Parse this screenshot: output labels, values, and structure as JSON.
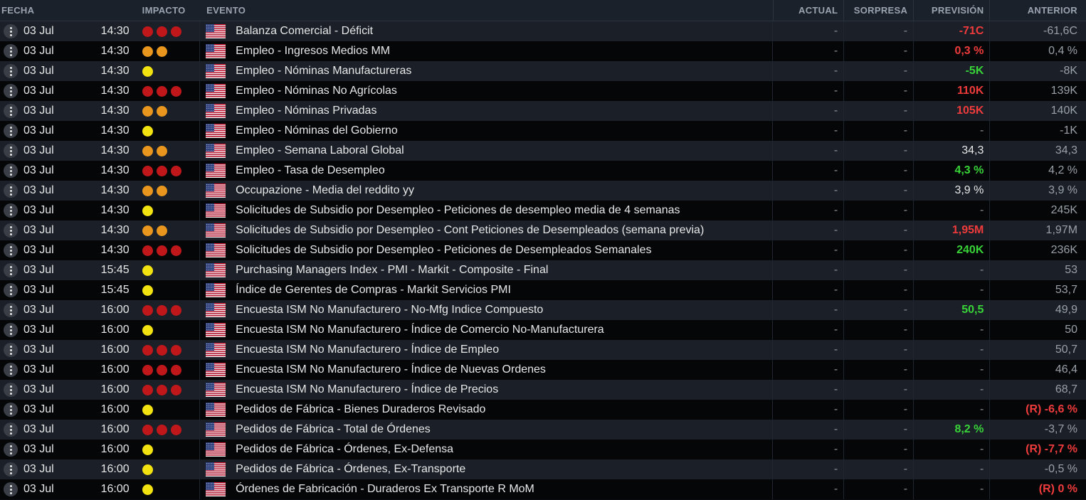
{
  "header": {
    "fecha": "FECHA",
    "impacto": "IMPACTO",
    "evento": "EVENTO",
    "actual": "ACTUAL",
    "sorpresa": "SORPRESA",
    "prevision": "PREVISIÓN",
    "anterior": "ANTERIOR"
  },
  "colors": {
    "high": "#c0171b",
    "medium": "#e8961e",
    "low": "#f2e20f",
    "red": "#ef3b3b",
    "green": "#38d438",
    "neutral": "#e8e8e8",
    "muted": "#9aa0a8"
  },
  "icons": {
    "menu": "more-vertical-icon",
    "flag": "us-flag-icon",
    "impact": "impact-dot-icon"
  },
  "rows": [
    {
      "date": "03 Jul",
      "time": "14:30",
      "impact": 3,
      "event": "Balanza Comercial - Déficit",
      "actual": "-",
      "surprise": "-",
      "forecast": "-71C",
      "forecast_color": "red",
      "previous": "-61,6C",
      "previous_color": "muted"
    },
    {
      "date": "03 Jul",
      "time": "14:30",
      "impact": 2,
      "event": "Empleo - Ingresos Medios MM",
      "actual": "-",
      "surprise": "-",
      "forecast": "0,3 %",
      "forecast_color": "red",
      "previous": "0,4 %",
      "previous_color": "muted"
    },
    {
      "date": "03 Jul",
      "time": "14:30",
      "impact": 1,
      "event": "Empleo - Nóminas Manufactureras",
      "actual": "-",
      "surprise": "-",
      "forecast": "-5K",
      "forecast_color": "green",
      "previous": "-8K",
      "previous_color": "muted"
    },
    {
      "date": "03 Jul",
      "time": "14:30",
      "impact": 3,
      "event": "Empleo - Nóminas No Agrícolas",
      "actual": "-",
      "surprise": "-",
      "forecast": "110K",
      "forecast_color": "red",
      "previous": "139K",
      "previous_color": "muted"
    },
    {
      "date": "03 Jul",
      "time": "14:30",
      "impact": 2,
      "event": "Empleo - Nóminas Privadas",
      "actual": "-",
      "surprise": "-",
      "forecast": "105K",
      "forecast_color": "red",
      "previous": "140K",
      "previous_color": "muted"
    },
    {
      "date": "03 Jul",
      "time": "14:30",
      "impact": 1,
      "event": "Empleo - Nóminas del Gobierno",
      "actual": "-",
      "surprise": "-",
      "forecast": "-",
      "forecast_color": "dash",
      "previous": "-1K",
      "previous_color": "muted"
    },
    {
      "date": "03 Jul",
      "time": "14:30",
      "impact": 2,
      "event": "Empleo - Semana Laboral Global",
      "actual": "-",
      "surprise": "-",
      "forecast": "34,3",
      "forecast_color": "neutral",
      "previous": "34,3",
      "previous_color": "muted"
    },
    {
      "date": "03 Jul",
      "time": "14:30",
      "impact": 3,
      "event": "Empleo - Tasa de Desempleo",
      "actual": "-",
      "surprise": "-",
      "forecast": "4,3 %",
      "forecast_color": "green",
      "previous": "4,2 %",
      "previous_color": "muted"
    },
    {
      "date": "03 Jul",
      "time": "14:30",
      "impact": 2,
      "event": "Occupazione - Media del reddito yy",
      "actual": "-",
      "surprise": "-",
      "forecast": "3,9 %",
      "forecast_color": "neutral",
      "previous": "3,9 %",
      "previous_color": "muted"
    },
    {
      "date": "03 Jul",
      "time": "14:30",
      "impact": 1,
      "event": "Solicitudes de Subsidio por Desempleo - Peticiones de desempleo media de 4 semanas",
      "actual": "-",
      "surprise": "-",
      "forecast": "-",
      "forecast_color": "dash",
      "previous": "245K",
      "previous_color": "muted"
    },
    {
      "date": "03 Jul",
      "time": "14:30",
      "impact": 2,
      "event": "Solicitudes de Subsidio por Desempleo - Cont Peticiones de Desempleados (semana previa)",
      "actual": "-",
      "surprise": "-",
      "forecast": "1,95M",
      "forecast_color": "red",
      "previous": "1,97M",
      "previous_color": "muted"
    },
    {
      "date": "03 Jul",
      "time": "14:30",
      "impact": 3,
      "event": "Solicitudes de Subsidio por Desempleo - Peticiones de Desempleados Semanales",
      "actual": "-",
      "surprise": "-",
      "forecast": "240K",
      "forecast_color": "green",
      "previous": "236K",
      "previous_color": "muted"
    },
    {
      "date": "03 Jul",
      "time": "15:45",
      "impact": 1,
      "event": "Purchasing Managers Index - PMI - Markit - Composite - Final",
      "actual": "-",
      "surprise": "-",
      "forecast": "-",
      "forecast_color": "dash",
      "previous": "53",
      "previous_color": "muted"
    },
    {
      "date": "03 Jul",
      "time": "15:45",
      "impact": 1,
      "event": "Índice de Gerentes de Compras - Markit Servicios PMI",
      "actual": "-",
      "surprise": "-",
      "forecast": "-",
      "forecast_color": "dash",
      "previous": "53,7",
      "previous_color": "muted"
    },
    {
      "date": "03 Jul",
      "time": "16:00",
      "impact": 3,
      "event": "Encuesta ISM No Manufacturero - No-Mfg Indice Compuesto",
      "actual": "-",
      "surprise": "-",
      "forecast": "50,5",
      "forecast_color": "green",
      "previous": "49,9",
      "previous_color": "muted"
    },
    {
      "date": "03 Jul",
      "time": "16:00",
      "impact": 1,
      "event": "Encuesta ISM No Manufacturero - Índice de Comercio No-Manufacturera",
      "actual": "-",
      "surprise": "-",
      "forecast": "-",
      "forecast_color": "dash",
      "previous": "50",
      "previous_color": "muted"
    },
    {
      "date": "03 Jul",
      "time": "16:00",
      "impact": 3,
      "event": "Encuesta ISM No Manufacturero - Índice de Empleo",
      "actual": "-",
      "surprise": "-",
      "forecast": "-",
      "forecast_color": "dash",
      "previous": "50,7",
      "previous_color": "muted"
    },
    {
      "date": "03 Jul",
      "time": "16:00",
      "impact": 3,
      "event": "Encuesta ISM No Manufacturero - Índice de Nuevas Ordenes",
      "actual": "-",
      "surprise": "-",
      "forecast": "-",
      "forecast_color": "dash",
      "previous": "46,4",
      "previous_color": "muted"
    },
    {
      "date": "03 Jul",
      "time": "16:00",
      "impact": 3,
      "event": "Encuesta ISM No Manufacturero - Índice de Precios",
      "actual": "-",
      "surprise": "-",
      "forecast": "-",
      "forecast_color": "dash",
      "previous": "68,7",
      "previous_color": "muted"
    },
    {
      "date": "03 Jul",
      "time": "16:00",
      "impact": 1,
      "event": "Pedidos de Fábrica - Bienes Duraderos Revisado",
      "actual": "-",
      "surprise": "-",
      "forecast": "-",
      "forecast_color": "dash",
      "previous": "(R) -6,6 %",
      "previous_color": "red"
    },
    {
      "date": "03 Jul",
      "time": "16:00",
      "impact": 3,
      "event": "Pedidos de Fábrica - Total de Órdenes",
      "actual": "-",
      "surprise": "-",
      "forecast": "8,2 %",
      "forecast_color": "green",
      "previous": "-3,7 %",
      "previous_color": "muted"
    },
    {
      "date": "03 Jul",
      "time": "16:00",
      "impact": 1,
      "event": "Pedidos de Fábrica - Órdenes, Ex-Defensa",
      "actual": "-",
      "surprise": "-",
      "forecast": "-",
      "forecast_color": "dash",
      "previous": "(R) -7,7 %",
      "previous_color": "red"
    },
    {
      "date": "03 Jul",
      "time": "16:00",
      "impact": 1,
      "event": "Pedidos de Fábrica - Órdenes, Ex-Transporte",
      "actual": "-",
      "surprise": "-",
      "forecast": "-",
      "forecast_color": "dash",
      "previous": "-0,5 %",
      "previous_color": "muted"
    },
    {
      "date": "03 Jul",
      "time": "16:00",
      "impact": 1,
      "event": "Órdenes de Fabricación - Duraderos Ex Transporte R MoM",
      "actual": "-",
      "surprise": "-",
      "forecast": "-",
      "forecast_color": "dash",
      "previous": "(R) 0 %",
      "previous_color": "red"
    }
  ]
}
